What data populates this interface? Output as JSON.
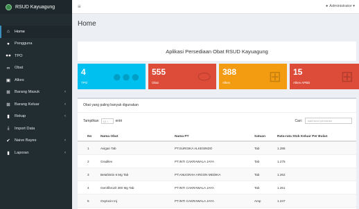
{
  "app": {
    "brand": "RSUD Kayuagung"
  },
  "topbar": {
    "menu_icon": "hamburger-icon",
    "user": "Administrator"
  },
  "sidebar": {
    "items": [
      {
        "label": "Home",
        "icon": "home-icon",
        "has_chevron": false
      },
      {
        "label": "Pengguna",
        "icon": "user-icon",
        "has_chevron": false
      },
      {
        "label": "TPO",
        "icon": "users-icon",
        "has_chevron": false
      },
      {
        "label": "Obat",
        "icon": "link-icon",
        "has_chevron": false
      },
      {
        "label": "Alkes",
        "icon": "cars-icon",
        "has_chevron": false
      },
      {
        "label": "Barang Masuk",
        "icon": "cart-icon",
        "has_chevron": true
      },
      {
        "label": "Barang Keluar",
        "icon": "cart-icon",
        "has_chevron": true
      },
      {
        "label": "Rekap",
        "icon": "file-icon",
        "has_chevron": true
      },
      {
        "label": "Import Data",
        "icon": "download-icon",
        "has_chevron": false
      },
      {
        "label": "Naive Bayes",
        "icon": "check-icon",
        "has_chevron": true
      },
      {
        "label": "Laporan",
        "icon": "file-icon",
        "has_chevron": true
      }
    ]
  },
  "page": {
    "title": "Home",
    "banner": "Aplikasi Persediaan Obat RSUD Kayuagung"
  },
  "stats": [
    {
      "value": "4",
      "label": "TPO",
      "color": "#00c0ef",
      "icon": "users-icon"
    },
    {
      "value": "555",
      "label": "Obat",
      "color": "#dd4b39",
      "icon": "pills-icon"
    },
    {
      "value": "388",
      "label": "Alkes",
      "color": "#f39c12",
      "icon": "medkit-icon"
    },
    {
      "value": "15",
      "label": "Alkes APBD",
      "color": "#dd4b39",
      "icon": "medkit-icon"
    }
  ],
  "table_panel": {
    "title": "Obat yang paling banyak digunakan",
    "show_prefix": "Tampilkan",
    "show_value": "10",
    "show_suffix": "entri",
    "search_label": "Cari:",
    "search_placeholder": "kata kunci pencarian",
    "columns": [
      "No",
      "Nama Obat",
      "Nama PT",
      "Satuan",
      "Rata-rata Stok Keluar Per Bulan"
    ],
    "rows": [
      [
        "1",
        "Avigan Tab",
        "PT.SURGIKA ALKESINDO",
        "Tab",
        "1.286"
      ],
      [
        "2",
        "Gradilex",
        "PT.INTI CAKRAWALA JAYA",
        "Tab",
        "1.275"
      ],
      [
        "3",
        "Betahistin 6 Mg Tab",
        "PT.ANUGRAH ARGON MEDIKA",
        "Tab",
        "1.262"
      ],
      [
        "4",
        "Gemfibrozil 300 Mg Tab",
        "PT.INTI CAKRAWALA JAYA",
        "Tab",
        "1.261"
      ],
      [
        "5",
        "Oxytocin Inj",
        "PT.INTI CAKRAWALA JAYA",
        "Amp",
        "1.247"
      ]
    ]
  }
}
